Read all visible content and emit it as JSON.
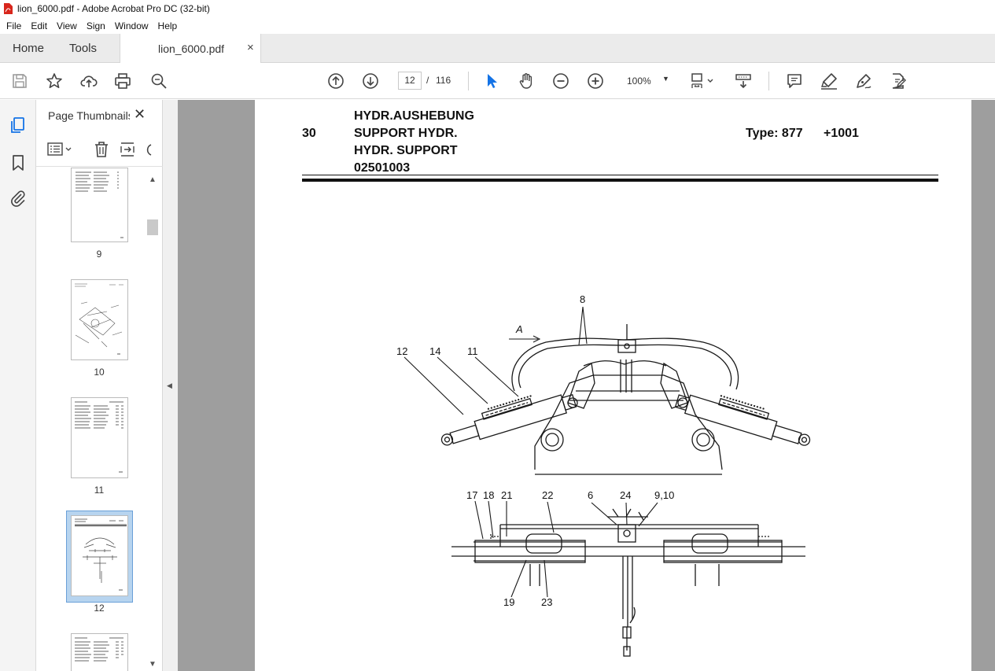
{
  "window": {
    "title": "lion_6000.pdf - Adobe Acrobat Pro DC (32-bit)"
  },
  "menu": [
    "File",
    "Edit",
    "View",
    "Sign",
    "Window",
    "Help"
  ],
  "tabs": {
    "home": "Home",
    "tools": "Tools",
    "document": "lion_6000.pdf",
    "close": "×"
  },
  "toolbar": {
    "current_page": "12",
    "separator": "/",
    "total_pages": "116",
    "zoom": "100%",
    "zoom_caret": "▼"
  },
  "panel": {
    "title": "Page Thumbnails",
    "close": "✕"
  },
  "thumbnails": [
    {
      "label": "9"
    },
    {
      "label": "10"
    },
    {
      "label": "11"
    },
    {
      "label": "12"
    }
  ],
  "scroll": {
    "up": "▲",
    "down": "▼",
    "collapse": "◀"
  },
  "document": {
    "header_line1": "HYDR.AUSHEBUNG",
    "header_line2": "SUPPORT HYDR.",
    "header_line3": "HYDR. SUPPORT",
    "header_line4": "02501003",
    "section": "30",
    "type_label": "Type: 877",
    "type_suffix": "+1001",
    "view_marker": "A",
    "callouts": {
      "c8": "8",
      "c12": "12",
      "c14": "14",
      "c11": "11",
      "c17": "17",
      "c18": "18",
      "c21": "21",
      "c22": "22",
      "c6": "6",
      "c24": "24",
      "c910": "9,10",
      "c19": "19",
      "c23": "23"
    }
  }
}
